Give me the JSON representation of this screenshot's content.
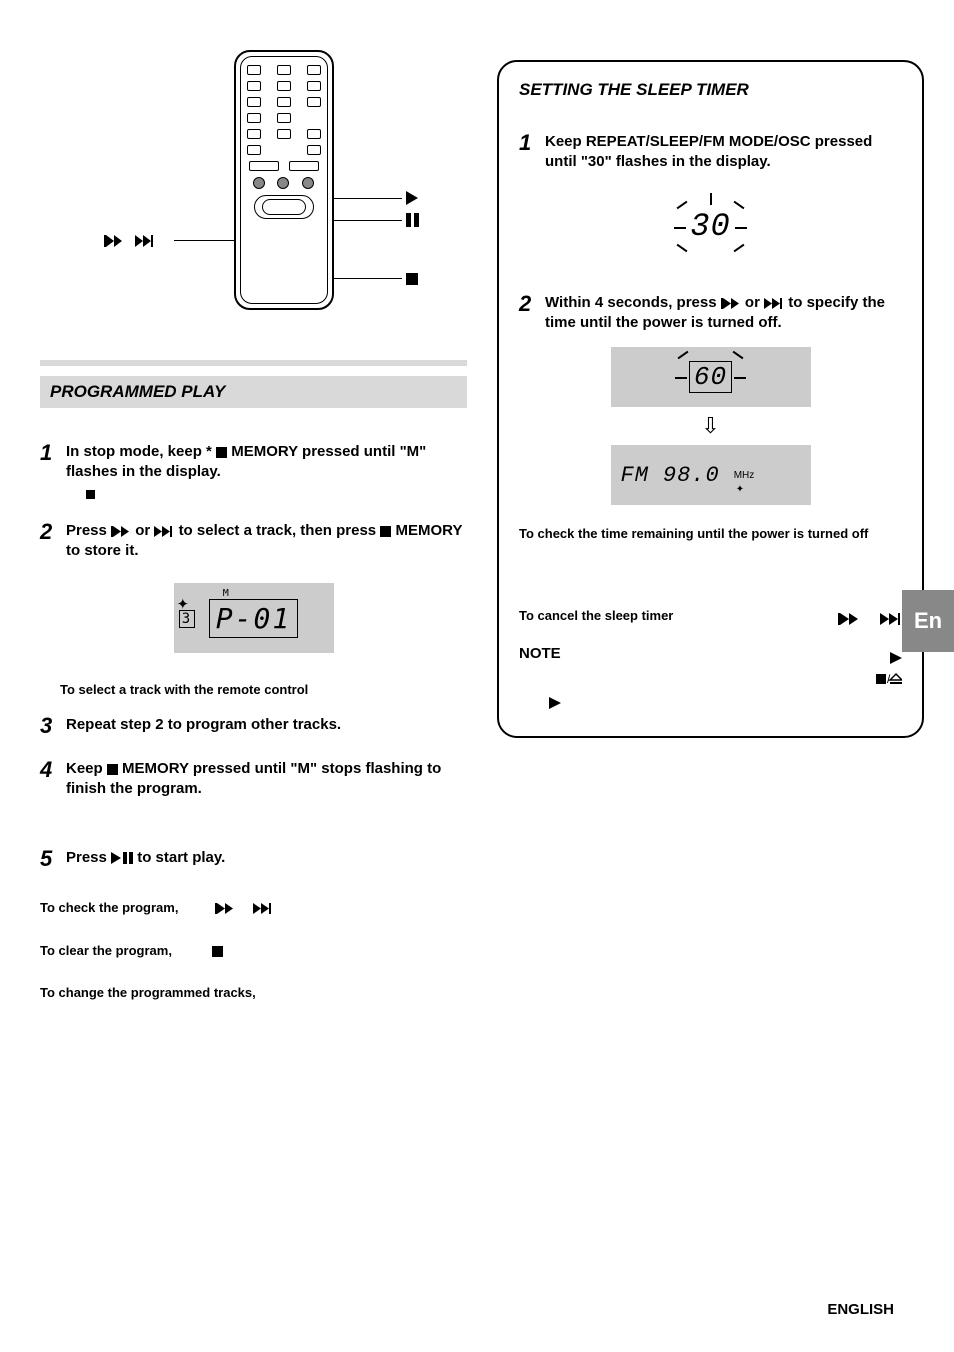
{
  "left": {
    "section_title": "PROGRAMMED PLAY",
    "steps": {
      "s1": {
        "num": "1",
        "text_a": "In stop mode, keep * ",
        "text_b": " MEMORY pressed until \"M\" flashes in the display."
      },
      "s2": {
        "num": "2",
        "text_a": "Press ",
        "text_b": " or ",
        "text_c": " to select a track, then press ",
        "text_d": " MEMORY to store it."
      },
      "lcd_text": "P-01",
      "sub_remote": "To select a track with the remote control",
      "s3": {
        "num": "3",
        "text": "Repeat step 2 to program other tracks."
      },
      "s4": {
        "num": "4",
        "text_a": "Keep ",
        "text_b": " MEMORY pressed until \"M\" stops flashing to finish the program."
      },
      "s5": {
        "num": "5",
        "text_a": "Press ",
        "text_b": " to start play."
      },
      "check": "To check the program,",
      "clear": "To clear the program,",
      "change": "To change the programmed tracks,"
    }
  },
  "right": {
    "panel_title": "SETTING THE SLEEP TIMER",
    "steps": {
      "s1": {
        "num": "1",
        "text": "Keep REPEAT/SLEEP/FM MODE/OSC pressed until \"30\" flashes in the display."
      },
      "lcd30": "30",
      "s2": {
        "num": "2",
        "text_a": "Within 4 seconds, press ",
        "text_b": " or ",
        "text_c": " to specify the time until the power is turned off."
      },
      "lcd60": "60",
      "fm": "FM",
      "freq": "98.0",
      "check_remaining": "To check the time remaining until the power is turned off",
      "cancel": "To cancel the sleep timer",
      "note": "NOTE"
    }
  },
  "side_tab": "En",
  "footer": "ENGLISH"
}
